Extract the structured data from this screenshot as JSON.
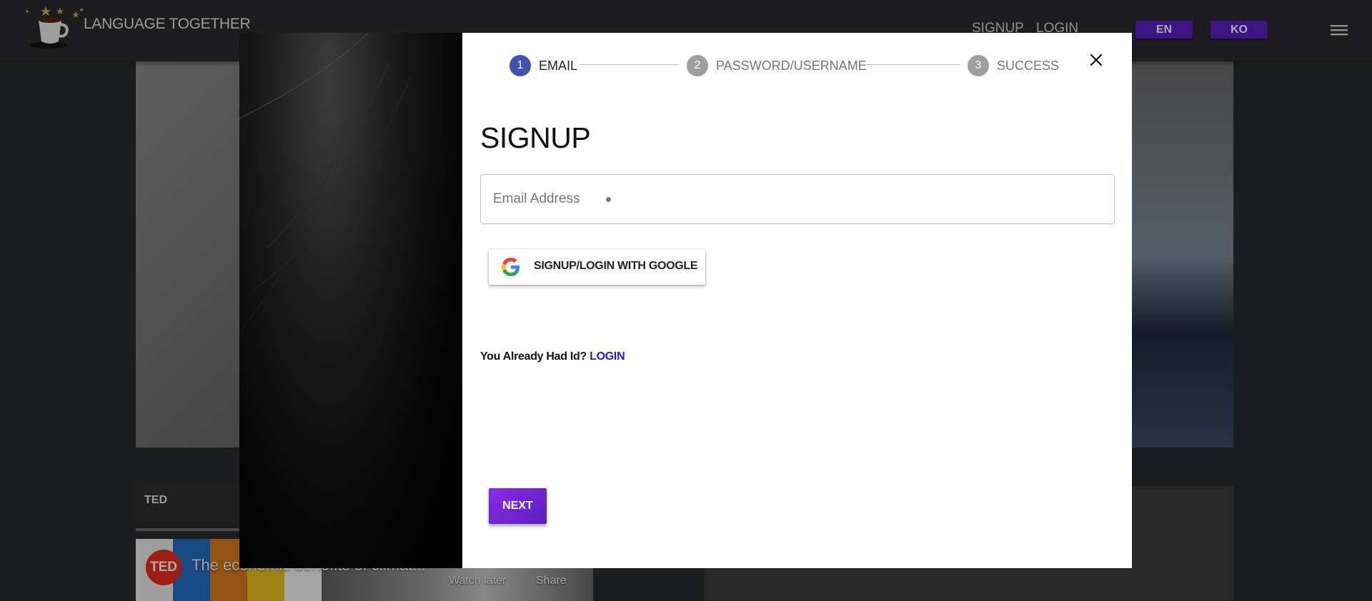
{
  "header": {
    "brand": "LANGUAGE TOGETHER",
    "nav": {
      "signup": "SIGNUP",
      "login": "LOGIN"
    },
    "languages": [
      "EN",
      "KO"
    ],
    "menu_icon": "hamburger-menu-icon"
  },
  "background": {
    "channel_label": "TED",
    "video": {
      "logo_text": "TED",
      "title": "The economic benefits of climat...",
      "watch_later": "Watch later",
      "share": "Share"
    }
  },
  "modal": {
    "steps": [
      {
        "number": "1",
        "label": "EMAIL",
        "active": true
      },
      {
        "number": "2",
        "label": "PASSWORD/USERNAME",
        "active": false
      },
      {
        "number": "3",
        "label": "SUCCESS",
        "active": false
      }
    ],
    "title": "SIGNUP",
    "email": {
      "placeholder": "Email Address",
      "value": "",
      "required": true
    },
    "google_button": "SIGNUP/LOGIN WITH GOOGLE",
    "already_text": "You Already Had Id?",
    "already_link": "LOGIN",
    "next_button": "NEXT",
    "close_icon": "close-icon"
  },
  "colors": {
    "accent": "#5a1fc2",
    "step_active": "#3f51b5",
    "step_inactive": "#9e9e9e",
    "link": "#1a1ae6"
  }
}
